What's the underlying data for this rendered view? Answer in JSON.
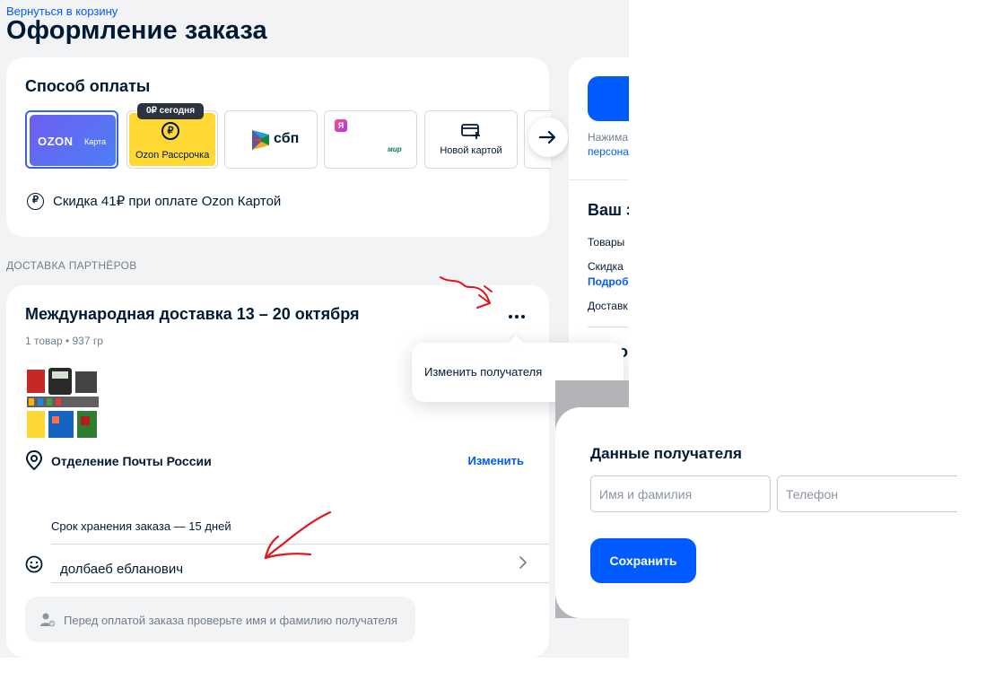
{
  "header": {
    "back_link": "Вернуться в корзину",
    "title": "Оформление заказа"
  },
  "payment": {
    "title": "Способ оплаты",
    "options": [
      {
        "brand": "OZON",
        "sub": "Карта",
        "selected": true
      },
      {
        "badge": "0₽ сегодня",
        "coin": "₽",
        "label": "Ozon Рассрочка"
      },
      {
        "label": "сбп"
      },
      {
        "icon_text": "Я",
        "sub": "мир"
      },
      {
        "label": "Новой картой"
      }
    ],
    "discount_coin": "₽",
    "discount_text": "Скидка 41₽ при оплате Ozon Картой"
  },
  "section_label": "ДОСТАВКА ПАРТНЁРОВ",
  "delivery": {
    "title": "Международная доставка 13 – 20 октября",
    "meta": "1 товар • 937 гр",
    "pickup_label": "Отделение Почты России",
    "change_link": "Изменить",
    "storage_text": "Срок хранения заказа — 15 дней",
    "recipient_name": "долбаеб ебланович",
    "warning": "Перед оплатой заказа проверьте имя и фамилию получателя"
  },
  "popover": {
    "item": "Изменить получателя"
  },
  "sidebar": {
    "note_line1": "Нажима",
    "note_line2": "персона",
    "heading": "Ваш з",
    "rows": [
      "Товары",
      "Скидка",
      "Доставк"
    ],
    "details_link": "Подроб",
    "heading2_fragment": "о"
  },
  "modal": {
    "title": "Данные получателя",
    "name_placeholder": "Имя и фамилия",
    "phone_placeholder": "Телефон",
    "save_label": "Сохранить"
  },
  "colors": {
    "accent": "#005bff",
    "text": "#001a34",
    "muted": "#707f8d",
    "page_bg": "#f2f3f5",
    "annotation": "#e0161c"
  },
  "icons": [
    "ruble-coin-icon",
    "arrow-right-icon",
    "more-dots-icon",
    "location-pin-icon",
    "smile-icon",
    "chevron-right-icon",
    "user-check-icon",
    "add-card-icon"
  ]
}
